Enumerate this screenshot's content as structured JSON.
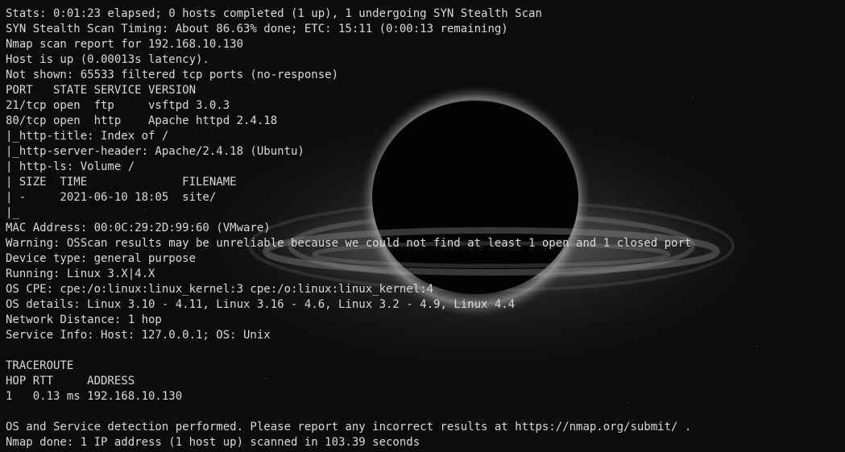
{
  "terminal": {
    "lines": [
      "Stats: 0:01:23 elapsed; 0 hosts completed (1 up), 1 undergoing SYN Stealth Scan",
      "SYN Stealth Scan Timing: About 86.63% done; ETC: 15:11 (0:00:13 remaining)",
      "Nmap scan report for 192.168.10.130",
      "Host is up (0.00013s latency).",
      "Not shown: 65533 filtered tcp ports (no-response)",
      "PORT   STATE SERVICE VERSION",
      "21/tcp open  ftp     vsftpd 3.0.3",
      "80/tcp open  http    Apache httpd 2.4.18",
      "|_http-title: Index of /",
      "|_http-server-header: Apache/2.4.18 (Ubuntu)",
      "| http-ls: Volume /",
      "| SIZE  TIME              FILENAME",
      "| -     2021-06-10 18:05  site/",
      "|_",
      "MAC Address: 00:0C:29:2D:99:60 (VMware)",
      "Warning: OSScan results may be unreliable because we could not find at least 1 open and 1 closed port",
      "Device type: general purpose",
      "Running: Linux 3.X|4.X",
      "OS CPE: cpe:/o:linux:linux_kernel:3 cpe:/o:linux:linux_kernel:4",
      "OS details: Linux 3.10 - 4.11, Linux 3.16 - 4.6, Linux 3.2 - 4.9, Linux 4.4",
      "Network Distance: 1 hop",
      "Service Info: Host: 127.0.0.1; OS: Unix",
      "",
      "TRACEROUTE",
      "HOP RTT     ADDRESS",
      "1   0.13 ms 192.168.10.130",
      "",
      "OS and Service detection performed. Please report any incorrect results at https://nmap.org/submit/ .",
      "Nmap done: 1 IP address (1 host up) scanned in 103.39 seconds"
    ]
  },
  "colors": {
    "background": "#0c0c0d",
    "text": "#d9d9d9"
  }
}
